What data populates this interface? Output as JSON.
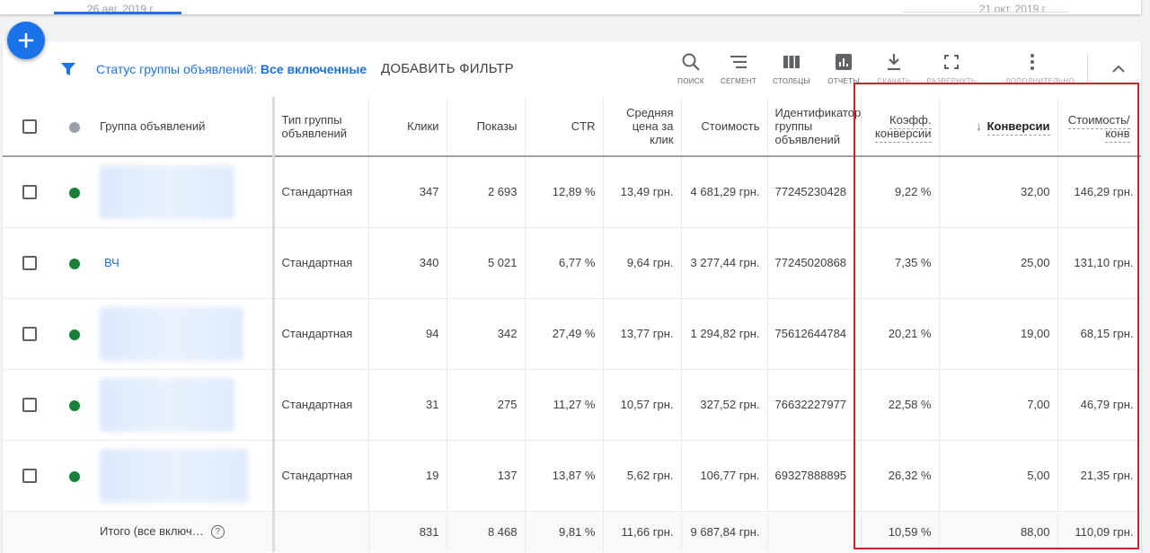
{
  "header": {
    "date_start": "26 авг. 2019 г.",
    "date_end": "21 окт. 2019 г."
  },
  "fab": {
    "icon": "plus-icon"
  },
  "filter": {
    "prefix": "Статус группы объявлений:",
    "value": "Все включенные",
    "add_label": "ДОБАВИТЬ ФИЛЬТР"
  },
  "toolbar": {
    "search": "ПОИСК",
    "segment": "СЕГМЕНТ",
    "columns": "СТОЛБЦЫ",
    "reports": "ОТЧЕТЫ",
    "download": "СКАЧАТЬ",
    "expand": "РАЗВЕРНУТЬ",
    "more": "ДОПОЛНИТЕЛЬНО"
  },
  "columns": {
    "name": "Группа объявлений",
    "type": "Тип группы объявлений",
    "clicks": "Клики",
    "impressions": "Показы",
    "ctr": "CTR",
    "avg_cpc": "Средняя цена за клик",
    "cost": "Стоимость",
    "id": "Идентификатор группы объявлений",
    "conv_rate": "Коэфф. конверсии",
    "conversions": "Конверсии",
    "cost_per_conv": "Стоимость/ конв"
  },
  "rows": [
    {
      "name": "",
      "type": "Стандартная",
      "clicks": "347",
      "impressions": "2 693",
      "ctr": "12,89 %",
      "avg_cpc": "13,49 грн.",
      "cost": "4 681,29 грн.",
      "id": "77245230428",
      "conv_rate": "9,22 %",
      "conversions": "32,00",
      "cost_per_conv": "146,29 грн."
    },
    {
      "name": "ВЧ",
      "type": "Стандартная",
      "clicks": "340",
      "impressions": "5 021",
      "ctr": "6,77 %",
      "avg_cpc": "9,64 грн.",
      "cost": "3 277,44 грн.",
      "id": "77245020868",
      "conv_rate": "7,35 %",
      "conversions": "25,00",
      "cost_per_conv": "131,10 грн."
    },
    {
      "name": "",
      "type": "Стандартная",
      "clicks": "94",
      "impressions": "342",
      "ctr": "27,49 %",
      "avg_cpc": "13,77 грн.",
      "cost": "1 294,82 грн.",
      "id": "75612644784",
      "conv_rate": "20,21 %",
      "conversions": "19,00",
      "cost_per_conv": "68,15 грн."
    },
    {
      "name": "",
      "type": "Стандартная",
      "clicks": "31",
      "impressions": "275",
      "ctr": "11,27 %",
      "avg_cpc": "10,57 грн.",
      "cost": "327,52 грн.",
      "id": "76632227977",
      "conv_rate": "22,58 %",
      "conversions": "7,00",
      "cost_per_conv": "46,79 грн."
    },
    {
      "name": "",
      "type": "Стандартная",
      "clicks": "19",
      "impressions": "137",
      "ctr": "13,87 %",
      "avg_cpc": "5,62 грн.",
      "cost": "106,77 грн.",
      "id": "69327888895",
      "conv_rate": "26,32 %",
      "conversions": "5,00",
      "cost_per_conv": "21,35 грн."
    }
  ],
  "totals": {
    "label": "Итого (все включ…",
    "clicks": "831",
    "impressions": "8 468",
    "ctr": "9,81 %",
    "avg_cpc": "11,66 грн.",
    "cost": "9 687,84 грн.",
    "conv_rate": "10,59 %",
    "conversions": "88,00",
    "cost_per_conv": "110,09 грн."
  },
  "colors": {
    "accent": "#1a73e8",
    "enabled_status": "#188038",
    "highlight_box": "#c8232c"
  }
}
